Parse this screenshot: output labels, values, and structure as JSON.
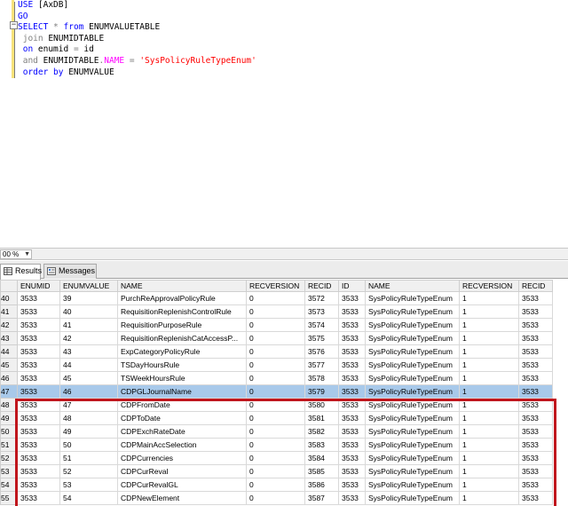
{
  "editor": {
    "lines": [
      [
        {
          "c": "kw",
          "t": "USE "
        },
        {
          "c": "tx",
          "t": "[AxDB]"
        }
      ],
      [
        {
          "c": "kw",
          "t": "GO"
        }
      ],
      [
        {
          "c": "kw",
          "t": "SELECT "
        },
        {
          "c": "gr",
          "t": "* "
        },
        {
          "c": "kw",
          "t": "from "
        },
        {
          "c": "tx",
          "t": "ENUMVALUETABLE"
        }
      ],
      [
        {
          "c": "gr",
          "t": " join "
        },
        {
          "c": "tx",
          "t": "ENUMIDTABLE"
        }
      ],
      [
        {
          "c": "kw",
          "t": " on "
        },
        {
          "c": "tx",
          "t": "enumid "
        },
        {
          "c": "gr",
          "t": "= "
        },
        {
          "c": "tx",
          "t": "id"
        }
      ],
      [
        {
          "c": "gr",
          "t": " and "
        },
        {
          "c": "tx",
          "t": "ENUMIDTABLE"
        },
        {
          "c": "gr",
          "t": "."
        },
        {
          "c": "fn",
          "t": "NAME"
        },
        {
          "c": "gr",
          "t": " = "
        },
        {
          "c": "st",
          "t": "'SysPolicyRuleTypeEnum'"
        }
      ],
      [
        {
          "c": "kw",
          "t": " order by "
        },
        {
          "c": "tx",
          "t": "ENUMVALUE"
        }
      ]
    ]
  },
  "zoom": {
    "value": "00 %"
  },
  "tabs": {
    "results": "Results",
    "messages": "Messages"
  },
  "grid": {
    "columns": [
      "",
      "ENUMID",
      "ENUMVALUE",
      "NAME",
      "RECVERSION",
      "RECID",
      "ID",
      "NAME",
      "RECVERSION",
      "RECID"
    ],
    "rows": [
      [
        "40",
        "3533",
        "39",
        "PurchReApprovalPolicyRule",
        "0",
        "3572",
        "3533",
        "SysPolicyRuleTypeEnum",
        "1",
        "3533"
      ],
      [
        "41",
        "3533",
        "40",
        "RequisitionReplenishControlRule",
        "0",
        "3573",
        "3533",
        "SysPolicyRuleTypeEnum",
        "1",
        "3533"
      ],
      [
        "42",
        "3533",
        "41",
        "RequisitionPurposeRule",
        "0",
        "3574",
        "3533",
        "SysPolicyRuleTypeEnum",
        "1",
        "3533"
      ],
      [
        "43",
        "3533",
        "42",
        "RequisitionReplenishCatAccessP...",
        "0",
        "3575",
        "3533",
        "SysPolicyRuleTypeEnum",
        "1",
        "3533"
      ],
      [
        "44",
        "3533",
        "43",
        "ExpCategoryPolicyRule",
        "0",
        "3576",
        "3533",
        "SysPolicyRuleTypeEnum",
        "1",
        "3533"
      ],
      [
        "45",
        "3533",
        "44",
        "TSDayHoursRule",
        "0",
        "3577",
        "3533",
        "SysPolicyRuleTypeEnum",
        "1",
        "3533"
      ],
      [
        "46",
        "3533",
        "45",
        "TSWeekHoursRule",
        "0",
        "3578",
        "3533",
        "SysPolicyRuleTypeEnum",
        "1",
        "3533"
      ],
      [
        "47",
        "3533",
        "46",
        "CDPGLJournalName",
        "0",
        "3579",
        "3533",
        "SysPolicyRuleTypeEnum",
        "1",
        "3533"
      ],
      [
        "48",
        "3533",
        "47",
        "CDPFromDate",
        "0",
        "3580",
        "3533",
        "SysPolicyRuleTypeEnum",
        "1",
        "3533"
      ],
      [
        "49",
        "3533",
        "48",
        "CDPToDate",
        "0",
        "3581",
        "3533",
        "SysPolicyRuleTypeEnum",
        "1",
        "3533"
      ],
      [
        "50",
        "3533",
        "49",
        "CDPExchRateDate",
        "0",
        "3582",
        "3533",
        "SysPolicyRuleTypeEnum",
        "1",
        "3533"
      ],
      [
        "51",
        "3533",
        "50",
        "CDPMainAccSelection",
        "0",
        "3583",
        "3533",
        "SysPolicyRuleTypeEnum",
        "1",
        "3533"
      ],
      [
        "52",
        "3533",
        "51",
        "CDPCurrencies",
        "0",
        "3584",
        "3533",
        "SysPolicyRuleTypeEnum",
        "1",
        "3533"
      ],
      [
        "53",
        "3533",
        "52",
        "CDPCurReval",
        "0",
        "3585",
        "3533",
        "SysPolicyRuleTypeEnum",
        "1",
        "3533"
      ],
      [
        "54",
        "3533",
        "53",
        "CDPCurRevalGL",
        "0",
        "3586",
        "3533",
        "SysPolicyRuleTypeEnum",
        "1",
        "3533"
      ],
      [
        "55",
        "3533",
        "54",
        "CDPNewElement",
        "0",
        "3587",
        "3533",
        "SysPolicyRuleTypeEnum",
        "1",
        "3533"
      ]
    ],
    "selected_row": 7
  },
  "colors": {
    "selection": "#a8c9ea",
    "highlight_border": "#c0161d",
    "keyword": "#0000ff",
    "string": "#ff0000"
  }
}
